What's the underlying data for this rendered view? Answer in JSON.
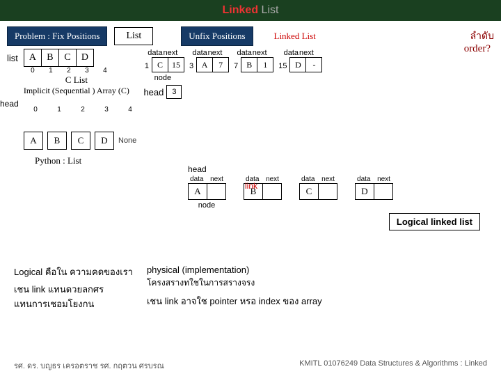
{
  "title": {
    "linked": "Linked",
    "list": "List"
  },
  "row1": {
    "problem": "Problem : Fix Positions",
    "listBtn": "List",
    "unfix": "Unfix Positions",
    "red": "Linked List",
    "thai": "ลำดับ",
    "order": "order?"
  },
  "arr": {
    "listLbl": "list",
    "cells": [
      "A",
      "B",
      "C",
      "D"
    ],
    "idx": [
      "0",
      "1",
      "2",
      "3",
      "4"
    ],
    "cap": "C List",
    "sub": "Implicit (Sequential ) Array (C)"
  },
  "nodes": {
    "dataLbl": "data",
    "nextLbl": "next",
    "ptrs": [
      "1",
      "3",
      "7",
      "15"
    ],
    "items": [
      {
        "d": "C",
        "n": "15"
      },
      {
        "d": "A",
        "n": "7"
      },
      {
        "d": "B",
        "n": "1"
      },
      {
        "d": "D",
        "n": "-"
      }
    ],
    "nodeCap": "node",
    "headLbl": "head",
    "headVal": "3"
  },
  "py": {
    "headLbl": "head",
    "idx": [
      "0",
      "1",
      "2",
      "3",
      "4"
    ],
    "cells": [
      "A",
      "B",
      "C",
      "D"
    ],
    "none": "None",
    "cap": "Python : List",
    "head2": "head"
  },
  "logical": {
    "dataLbl": "data",
    "nextLbl": "next",
    "items": [
      "A",
      "B",
      "C",
      "D"
    ],
    "link": "link",
    "badge": "Logical linked list",
    "nodeCap": "node"
  },
  "bottom": {
    "l1a": "Logical",
    "l1b": " คือใน  ความคดของเรา",
    "l2": "เชน   link แทนดวยลกศร",
    "l3": "แทนการเชอมโยงกน",
    "r1": "physical (implementation)",
    "r2": "โครงสรางทใชในการสรางจรง",
    "r3": "เชน   link อาจใช   pointer หรอ   index ของ array"
  },
  "footer": {
    "left": "รศ. ดร. บญธร    เครอตราช        รศ. กฤตวน   ศรบรณ",
    "right": "KMITL   01076249 Data Structures & Algorithms : Linked"
  }
}
